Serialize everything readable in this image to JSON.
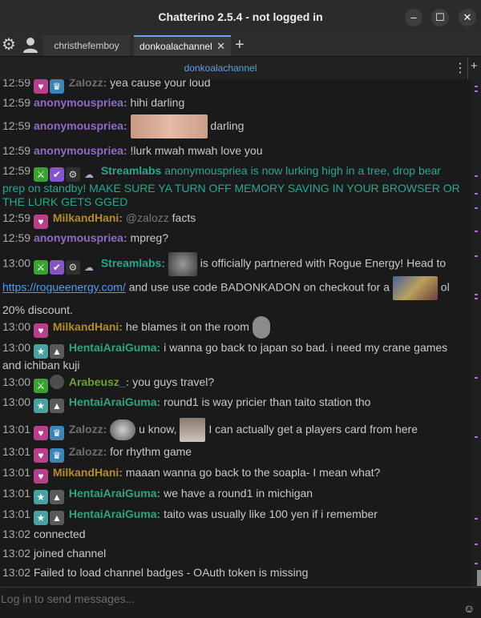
{
  "window": {
    "title": "Chatterino 2.5.4 - not logged in",
    "minimize": "–",
    "maximize": "☐",
    "close": "✕"
  },
  "tabs": {
    "settings_icon": "⚙",
    "account_icon": "👤",
    "tab1": "christhefemboy",
    "tab2": "donkoalachannel",
    "tab_close": "✕",
    "add": "+"
  },
  "header": {
    "channel": "donkoalachannel",
    "menu": "⋮",
    "add_split": "+"
  },
  "badge_glyphs": {
    "heart": "♥",
    "crown": "♛",
    "sword": "⚔",
    "verified": "✔",
    "gear": "⚙",
    "bot": "☁",
    "star": "★",
    "triangle": "▲"
  },
  "messages": [
    {
      "time": "12:59",
      "user": "Zalozz:",
      "text": "yea cause your loud"
    },
    {
      "time": "12:59",
      "user": "anonymouspriea:",
      "text": "hihi darling"
    },
    {
      "time": "12:59",
      "user": "anonymouspriea:",
      "text": "darling"
    },
    {
      "time": "12:59",
      "user": "anonymouspriea:",
      "text": "!lurk mwah mwah love you"
    },
    {
      "time": "12:59",
      "user": "Streamlabs",
      "text": "anonymouspriea is now lurking high in a tree, drop bear prep on standby! MAKE SURE YA TURN OFF MEMORY SAVING IN YOUR BROWSER OR THE LURK GETS GGED"
    },
    {
      "time": "12:59",
      "user": "MilkandHani:",
      "mention": "@zalozz",
      "text": "facts"
    },
    {
      "time": "12:59",
      "user": "anonymouspriea:",
      "text": "mpreg?"
    },
    {
      "time": "13:00",
      "user": "Streamlabs:",
      "text_a": "is officially partnered with Rogue Energy! Head to",
      "link": "https://rogueenergy.com/",
      "text_b": "and use use code BADONKADON on checkout for a",
      "text_c": "ol 20% discount."
    },
    {
      "time": "13:00",
      "user": "MilkandHani:",
      "text": "he blames it on the room"
    },
    {
      "time": "13:00",
      "user": "HentaiAraiGuma:",
      "text": "i wanna go back to japan so bad. i need my crane games and ichiban kuji"
    },
    {
      "time": "13:00",
      "user": "Arabeusz_:",
      "text": "you guys travel?"
    },
    {
      "time": "13:00",
      "user": "HentaiAraiGuma:",
      "text": "round1 is way pricier than taito station tho"
    },
    {
      "time": "13:01",
      "user": "Zalozz:",
      "text_a": "u know,",
      "text_b": "I can actually get a players card from here"
    },
    {
      "time": "13:01",
      "user": "Zalozz:",
      "text": "for rhythm game"
    },
    {
      "time": "13:01",
      "user": "MilkandHani:",
      "text": "maaan wanna go back to the soapla- I mean what?"
    },
    {
      "time": "13:01",
      "user": "HentaiAraiGuma:",
      "text": "we have a round1 in michigan"
    },
    {
      "time": "13:01",
      "user": "HentaiAraiGuma:",
      "text": "taito was usually like 100 yen if i remember"
    },
    {
      "time": "13:02",
      "text": "connected"
    },
    {
      "time": "13:02",
      "text": "joined channel"
    },
    {
      "time": "13:02",
      "text": "Failed to load channel badges - OAuth token is missing"
    }
  ],
  "input": {
    "placeholder": "Log in to send messages...",
    "emoji_icon": "☺"
  }
}
